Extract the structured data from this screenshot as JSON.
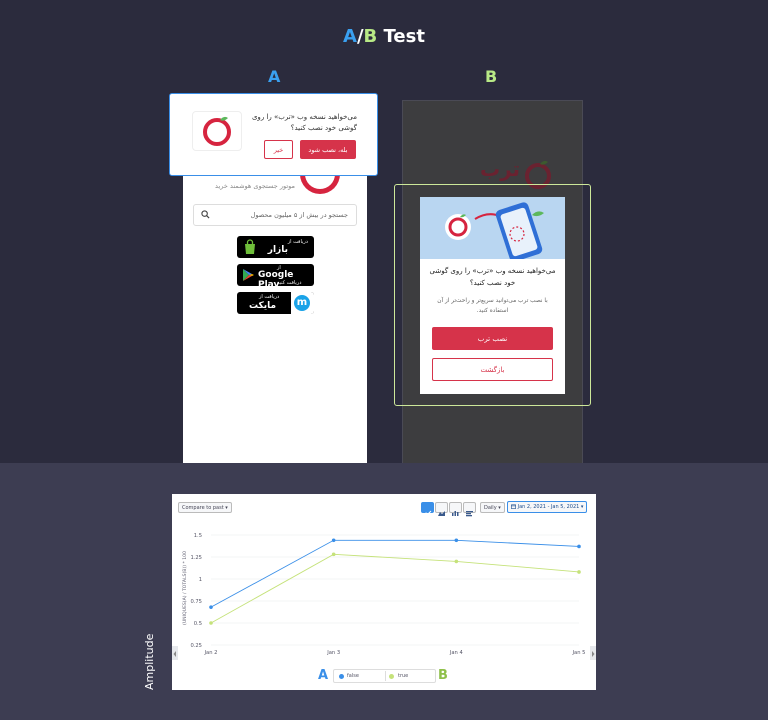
{
  "title": {
    "a": "A",
    "sep": "/",
    "b": "B",
    "rest": " Test"
  },
  "variant_a": {
    "label": "A",
    "tagline": "موتور جستجوی هوشمند خرید",
    "search_placeholder": "جستجو در بیش از ۵ میلیون محصول",
    "popup": {
      "question": "می‌خواهید نسخه وب «ترب» را روی گوشی خود نصب کنید؟",
      "yes_label": "بله، نصب شود",
      "no_label": "خیر"
    },
    "stores": [
      {
        "top": "دریافت از",
        "name": "بازار"
      },
      {
        "top": "از",
        "name": "Google Play",
        "sub": "دریافت کنید"
      },
      {
        "top": "دریافت از",
        "name": "مایکت"
      }
    ]
  },
  "variant_b": {
    "label": "B",
    "brand": "ترب",
    "popup": {
      "question": "می‌خواهید نسخه وب «ترب» را روی گوشی خود نصب کنید؟",
      "description": "با نصب ترب می‌توانید سریع‌تر و راحت‌تر از آن استفاده کنید.",
      "install_label": "نصب ترب",
      "back_label": "بازگشت"
    }
  },
  "toolbar": {
    "compare_label": "Compare to past ▾",
    "interval_label": "Daily ▾",
    "date_range": "Jan 2, 2021 - Jan 5, 2021 ▾"
  },
  "side_label": "Amplitude",
  "legend_marks": {
    "a": "A",
    "b": "B"
  },
  "colors": {
    "accent": "#3a8fe8",
    "brand_red": "#d6334a",
    "series_false": "#3a8fe8",
    "series_true": "#c5e27a"
  },
  "chart_data": {
    "type": "line",
    "ylabel": "(UNIQUES(A) / TOTALS(B)) * 100",
    "x": [
      "Jan 2",
      "Jan 3",
      "Jan 4",
      "Jan 5"
    ],
    "yticks": [
      "1.5",
      "1.25",
      "1",
      "0.75",
      "0.5",
      "0.25"
    ],
    "ylim": [
      0.25,
      1.5
    ],
    "series": [
      {
        "name": "false",
        "values": [
          0.68,
          1.44,
          1.44,
          1.37
        ]
      },
      {
        "name": "true",
        "values": [
          0.5,
          1.28,
          1.2,
          1.08
        ]
      }
    ],
    "grid": true
  }
}
